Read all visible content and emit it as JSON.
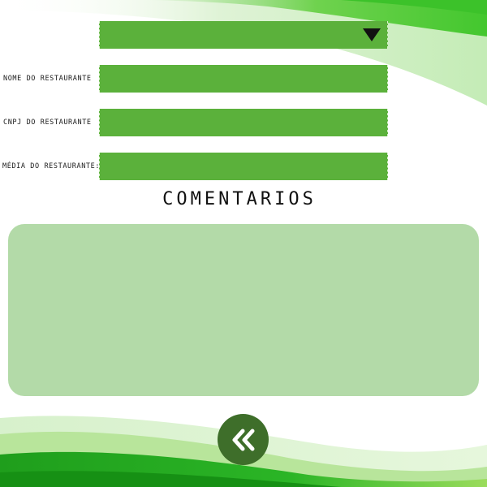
{
  "form": {
    "select": {
      "value": "",
      "icon": "caret-down-icon"
    },
    "fields": [
      {
        "label": "NOME DO RESTAURANTE",
        "value": ""
      },
      {
        "label": "CNPJ DO RESTAURANTE",
        "value": ""
      },
      {
        "label": "MÉDIA DO RESTAURANTE:",
        "value": ""
      }
    ]
  },
  "comments": {
    "title": "COMENTARIOS",
    "value": ""
  },
  "navigation": {
    "back_icon": "double-chevron-left-icon"
  },
  "colors": {
    "field": "#5bb13b",
    "comments_box": "#b3daa8",
    "back_button": "#3e6e2a",
    "wave_green": "#2fb52a"
  }
}
